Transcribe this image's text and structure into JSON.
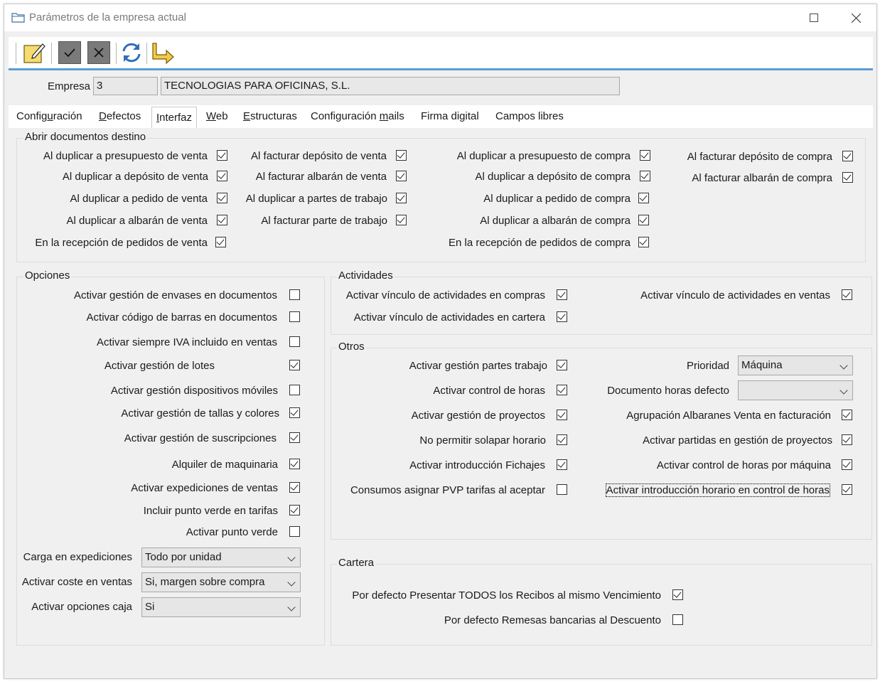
{
  "window": {
    "title": "Parámetros de la empresa actual",
    "minimize": "—",
    "maximize": "☐",
    "close": "✕"
  },
  "empresa": {
    "label": "Empresa",
    "code": "3",
    "name": "TECNOLOGIAS PARA OFICINAS, S.L."
  },
  "tabs": [
    {
      "label": "Configuración",
      "accel": "u"
    },
    {
      "label": "Defectos",
      "accel": "D"
    },
    {
      "label": "Interfaz",
      "accel": "I"
    },
    {
      "label": "Web",
      "accel": "W"
    },
    {
      "label": "Estructuras",
      "accel": "E"
    },
    {
      "label": "Configuración mails",
      "accel": "m"
    },
    {
      "label": "Firma digital",
      "accel": ""
    },
    {
      "label": "Campos libres",
      "accel": ""
    }
  ],
  "abrir": {
    "title": "Abrir documentos destino",
    "col1": [
      {
        "label": "Al duplicar a presupuesto de venta",
        "checked": true
      },
      {
        "label": "Al duplicar a depósito de venta",
        "checked": true
      },
      {
        "label": "Al duplicar a pedido de venta",
        "checked": true
      },
      {
        "label": "Al duplicar a albarán de venta",
        "checked": true
      },
      {
        "label": "En la recepción de pedidos de venta",
        "checked": true
      }
    ],
    "col2": [
      {
        "label": "Al facturar depósito de venta",
        "checked": true
      },
      {
        "label": "Al facturar albarán de venta",
        "checked": true
      },
      {
        "label": "Al duplicar a partes de trabajo",
        "checked": true
      },
      {
        "label": "Al facturar parte de trabajo",
        "checked": true
      }
    ],
    "col3": [
      {
        "label": "Al duplicar a presupuesto de compra",
        "checked": true
      },
      {
        "label": "Al duplicar a depósito de compra",
        "checked": true
      },
      {
        "label": "Al duplicar a pedido de compra",
        "checked": true
      },
      {
        "label": "Al duplicar a albarán de compra",
        "checked": true
      },
      {
        "label": "En la recepción de pedidos de compra",
        "checked": true
      }
    ],
    "col4": [
      {
        "label": "Al facturar depósito de compra",
        "checked": true
      },
      {
        "label": "Al facturar albarán de compra",
        "checked": true
      }
    ]
  },
  "opciones": {
    "title": "Opciones",
    "items": [
      {
        "label": "Activar gestión de envases en documentos",
        "checked": false
      },
      {
        "label": "Activar código de barras en documentos",
        "checked": false
      },
      {
        "label": "Activar siempre IVA incluido en ventas",
        "checked": false
      },
      {
        "label": "Activar gestión de lotes",
        "checked": true
      },
      {
        "label": "Activar gestión dispositivos móviles",
        "checked": false
      },
      {
        "label": "Activar gestión de tallas y colores",
        "checked": true
      },
      {
        "label": "Activar gestión de suscripciones",
        "checked": true
      },
      {
        "label": "Alquiler de maquinaria",
        "checked": true
      },
      {
        "label": "Activar expediciones de ventas",
        "checked": true
      },
      {
        "label": "Incluir punto verde en tarifas",
        "checked": true
      },
      {
        "label": "Activar punto verde",
        "checked": false
      }
    ],
    "selects": [
      {
        "label": "Carga en expediciones",
        "value": "Todo por unidad"
      },
      {
        "label": "Activar coste en ventas",
        "value": "Si, margen sobre compra"
      },
      {
        "label": "Activar opciones caja",
        "value": "Si"
      }
    ]
  },
  "actividades": {
    "title": "Actividades",
    "items": [
      {
        "label": "Activar vínculo de actividades en compras",
        "checked": true
      },
      {
        "label": "Activar vínculo de actividades en cartera",
        "checked": true
      },
      {
        "label": "Activar vínculo de actividades en ventas",
        "checked": true
      }
    ]
  },
  "otros": {
    "title": "Otros",
    "left": [
      {
        "label": "Activar gestión partes trabajo",
        "checked": true
      },
      {
        "label": "Activar control de horas",
        "checked": true
      },
      {
        "label": "Activar gestión de proyectos",
        "checked": true
      },
      {
        "label": "No permitir solapar horario",
        "checked": true
      },
      {
        "label": "Activar introducción Fichajes",
        "checked": true
      },
      {
        "label": "Consumos asignar PVP tarifas al aceptar",
        "checked": false
      }
    ],
    "prioridad": {
      "label": "Prioridad",
      "value": "Máquina"
    },
    "doc_horas": {
      "label": "Documento horas defecto",
      "value": ""
    },
    "right": [
      {
        "label": "Agrupación Albaranes Venta en facturación",
        "checked": true
      },
      {
        "label": "Activar partidas en gestión de proyectos",
        "checked": true
      },
      {
        "label": "Activar control de horas por máquina",
        "checked": true
      },
      {
        "label": "Activar introducción horario en control de horas",
        "checked": true
      }
    ]
  },
  "cartera": {
    "title": "Cartera",
    "items": [
      {
        "label": "Por defecto Presentar TODOS los Recibos al mismo Vencimiento",
        "checked": true
      },
      {
        "label": "Por defecto Remesas bancarias al Descuento",
        "checked": false
      }
    ]
  }
}
